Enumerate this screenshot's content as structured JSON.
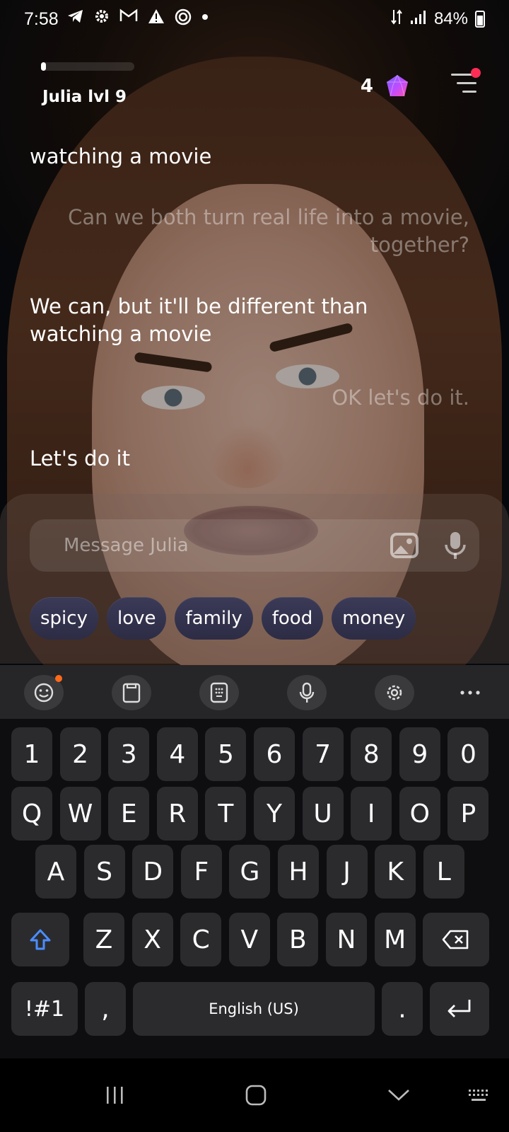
{
  "status_bar": {
    "time": "7:58",
    "battery": "84%",
    "icons": [
      "telegram-icon",
      "settings-icon",
      "gmail-icon",
      "alert-icon",
      "target-icon",
      "dot-icon"
    ]
  },
  "header": {
    "level_label": "Julia lvl 9",
    "level_progress": 0.05,
    "gem_count": "4"
  },
  "messages": [
    {
      "sender": "bot",
      "text": "watching a movie"
    },
    {
      "sender": "user",
      "line1": "Can we both turn real life into a movie,",
      "line2": "together?"
    },
    {
      "sender": "bot",
      "line1": "We can, but it'll be different than",
      "line2": "watching a movie"
    },
    {
      "sender": "user",
      "text": "OK let's do it."
    },
    {
      "sender": "bot",
      "text": "Let's do it"
    }
  ],
  "composer": {
    "placeholder": "Message Julia",
    "chips": [
      "spicy",
      "love",
      "family",
      "food",
      "money"
    ]
  },
  "keyboard": {
    "row_numbers": [
      "1",
      "2",
      "3",
      "4",
      "5",
      "6",
      "7",
      "8",
      "9",
      "0"
    ],
    "row_top": [
      "Q",
      "W",
      "E",
      "R",
      "T",
      "Y",
      "U",
      "I",
      "O",
      "P"
    ],
    "row_mid": [
      "A",
      "S",
      "D",
      "F",
      "G",
      "H",
      "J",
      "K",
      "L"
    ],
    "row_bottom": [
      "Z",
      "X",
      "C",
      "V",
      "B",
      "N",
      "M"
    ],
    "symbols_key": "!#1",
    "comma_key": ",",
    "space_label": "English (US)",
    "period_key": "."
  }
}
